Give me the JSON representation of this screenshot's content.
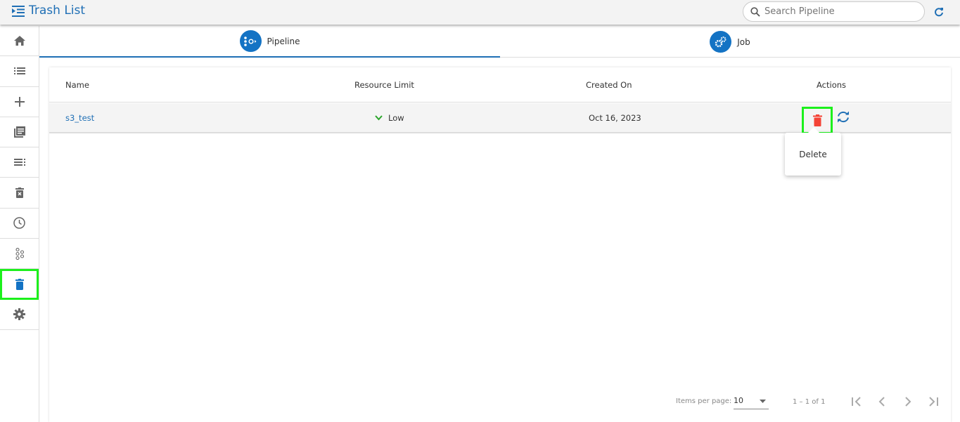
{
  "header": {
    "title": "Trash List",
    "search_placeholder": "Search Pipeline"
  },
  "sidebar": {
    "items": [
      {
        "name": "home"
      },
      {
        "name": "list"
      },
      {
        "name": "create"
      },
      {
        "name": "library"
      },
      {
        "name": "queue"
      },
      {
        "name": "trash-x"
      },
      {
        "name": "history"
      },
      {
        "name": "components"
      },
      {
        "name": "trash",
        "active": true
      },
      {
        "name": "settings"
      }
    ]
  },
  "tabs": [
    {
      "label": "Pipeline",
      "active": true
    },
    {
      "label": "Job"
    }
  ],
  "table": {
    "columns": [
      "Name",
      "Resource Limit",
      "Created On",
      "Actions"
    ],
    "rows": [
      {
        "name": "s3_test",
        "resource_limit": "Low",
        "created_on": "Oct 16, 2023"
      }
    ]
  },
  "popup": {
    "label": "Delete"
  },
  "paginator": {
    "items_per_page_label": "Items per page:",
    "items_per_page": "10",
    "range": "1 – 1 of 1"
  },
  "colors": {
    "accent": "#1f6fb5",
    "delete": "#f44336",
    "highlight": "#1cf01c"
  }
}
